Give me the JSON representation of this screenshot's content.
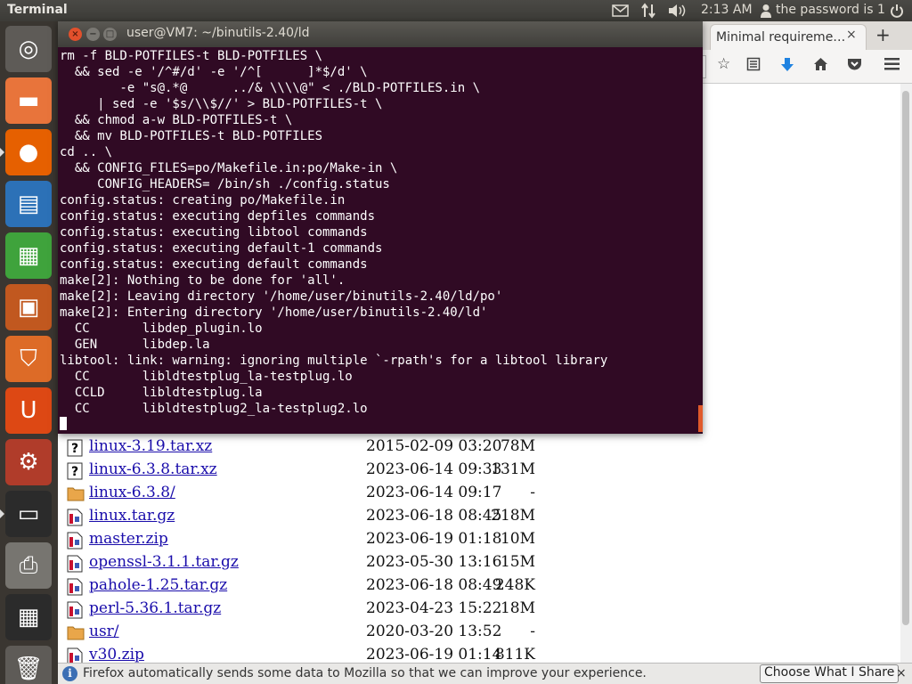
{
  "top_panel": {
    "app_title": "Terminal",
    "clock": "2:13 AM",
    "user_label": "the password is 1",
    "icons": [
      "mail-icon",
      "network-icon",
      "volume-icon",
      "user-icon",
      "power-icon"
    ]
  },
  "launcher": {
    "items": [
      {
        "name": "dash-home",
        "glyph": "◎",
        "color": "#5e5b57"
      },
      {
        "name": "files",
        "glyph": "▬",
        "color": "#e8743b"
      },
      {
        "name": "firefox",
        "glyph": "●",
        "color": "#e66000"
      },
      {
        "name": "libreoffice-writer",
        "glyph": "▤",
        "color": "#2c71b7"
      },
      {
        "name": "libreoffice-calc",
        "glyph": "▦",
        "color": "#3fa33c"
      },
      {
        "name": "libreoffice-impress",
        "glyph": "▣",
        "color": "#c1581f"
      },
      {
        "name": "software-center",
        "glyph": "⛉",
        "color": "#dd6b27"
      },
      {
        "name": "ubuntu-one",
        "glyph": "U",
        "color": "#dd4814"
      },
      {
        "name": "system-settings",
        "glyph": "⚙",
        "color": "#b03c2a"
      },
      {
        "name": "terminal",
        "glyph": "▭",
        "color": "#2b2b2b"
      },
      {
        "name": "printer",
        "glyph": "⎙",
        "color": "#777570"
      },
      {
        "name": "workspace-switcher",
        "glyph": "▦",
        "color": "#2b2b2b"
      },
      {
        "name": "trash",
        "glyph": "🗑",
        "color": "#5e5b57"
      }
    ]
  },
  "terminal": {
    "title": "user@VM7: ~/binutils-2.40/ld",
    "lines": [
      "rm -f BLD-POTFILES-t BLD-POTFILES \\",
      "  && sed -e '/^#/d' -e '/^[      ]*$/d' \\",
      "        -e \"s@.*@      ../& \\\\\\\\@\" < ./BLD-POTFILES.in \\",
      "     | sed -e '$s/\\\\$//' > BLD-POTFILES-t \\",
      "  && chmod a-w BLD-POTFILES-t \\",
      "  && mv BLD-POTFILES-t BLD-POTFILES",
      "cd .. \\",
      "  && CONFIG_FILES=po/Makefile.in:po/Make-in \\",
      "     CONFIG_HEADERS= /bin/sh ./config.status",
      "config.status: creating po/Makefile.in",
      "config.status: executing depfiles commands",
      "config.status: executing libtool commands",
      "config.status: executing default-1 commands",
      "config.status: executing default commands",
      "make[2]: Nothing to be done for 'all'.",
      "make[2]: Leaving directory '/home/user/binutils-2.40/ld/po'",
      "make[2]: Entering directory '/home/user/binutils-2.40/ld'",
      "  CC       libdep_plugin.lo",
      "  GEN      libdep.la",
      "libtool: link: warning: ignoring multiple `-rpath's for a libtool library",
      "  CC       libldtestplug_la-testplug.lo",
      "  CCLD     libldtestplug.la",
      "  CC       libldtestplug2_la-testplug2.lo"
    ]
  },
  "browser": {
    "tab_title": "Minimal requireme…",
    "tab_close": "×",
    "new_tab": "+",
    "files": [
      {
        "name": "linux-3.19.tar.xz",
        "date": "2015-02-09 03:20",
        "size": "78M",
        "kind": "unknown"
      },
      {
        "name": "linux-6.3.8.tar.xz",
        "date": "2023-06-14 09:33",
        "size": "131M",
        "kind": "unknown"
      },
      {
        "name": "linux-6.3.8/",
        "date": "2023-06-14 09:17",
        "size": "-",
        "kind": "folder"
      },
      {
        "name": "linux.tar.gz",
        "date": "2023-06-18 08:45",
        "size": "218M",
        "kind": "archive"
      },
      {
        "name": "master.zip",
        "date": "2023-06-19 01:18",
        "size": "10M",
        "kind": "archive"
      },
      {
        "name": "openssl-3.1.1.tar.gz",
        "date": "2023-05-30 13:16",
        "size": "15M",
        "kind": "archive"
      },
      {
        "name": "pahole-1.25.tar.gz",
        "date": "2023-06-18 08:49",
        "size": "248K",
        "kind": "archive"
      },
      {
        "name": "perl-5.36.1.tar.gz",
        "date": "2023-04-23 15:22",
        "size": "18M",
        "kind": "archive"
      },
      {
        "name": "usr/",
        "date": "2020-03-20 13:52",
        "size": "-",
        "kind": "folder"
      },
      {
        "name": "v30.zip",
        "date": "2023-06-19 01:14",
        "size": "811K",
        "kind": "archive"
      }
    ],
    "notice": {
      "text": "Firefox automatically sends some data to Mozilla so that we can improve your experience.",
      "button": "Choose What I Share",
      "close": "×"
    }
  }
}
